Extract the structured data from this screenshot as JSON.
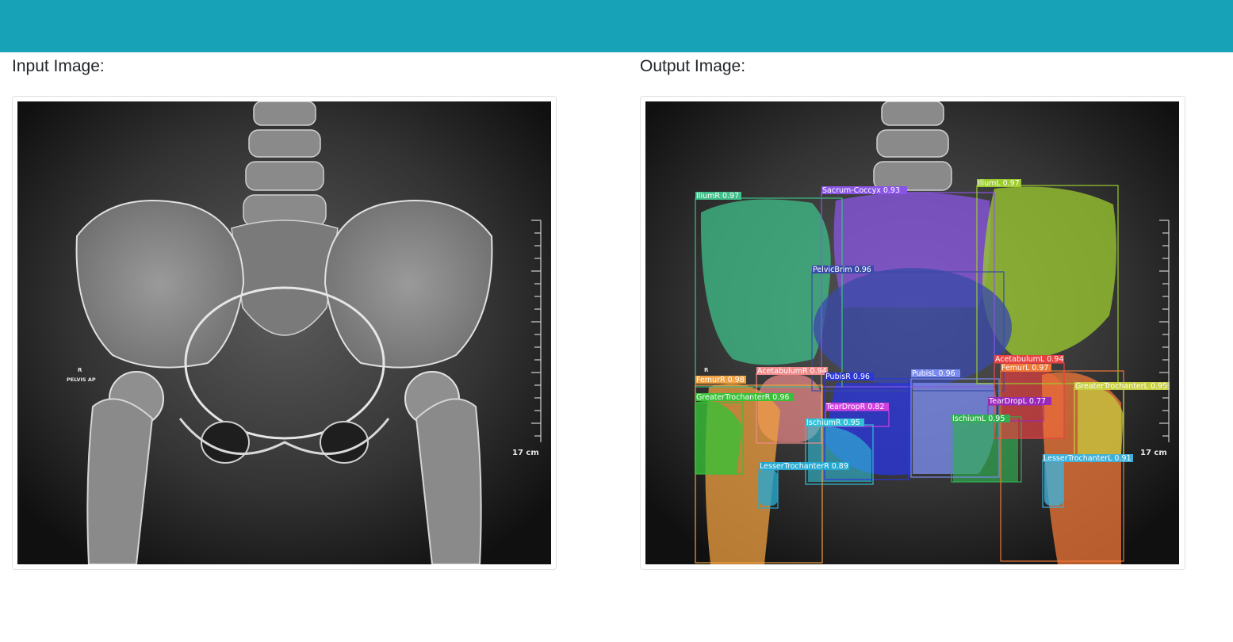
{
  "header": {
    "color": "#17a2b8"
  },
  "input_panel": {
    "title": "Input Image:",
    "image": {
      "side_marker": "R",
      "view_label": "PELVIS AP",
      "scale_label": "17 cm"
    }
  },
  "output_panel": {
    "title": "Output Image:",
    "image": {
      "side_marker": "R",
      "scale_label": "17 cm"
    },
    "detections": [
      {
        "label": "IliumR 0.97",
        "color": "#3fbf8a"
      },
      {
        "label": "Sacrum-Coccyx 0.93",
        "color": "#8a55e6"
      },
      {
        "label": "IliumL 0.97",
        "color": "#9ccc2e"
      },
      {
        "label": "PelvicBrim 0.96",
        "color": "#3a4aa8"
      },
      {
        "label": "AcetabulumR 0.94",
        "color": "#f08a8a"
      },
      {
        "label": "FemurR 0.98",
        "color": "#f0a040"
      },
      {
        "label": "PubisR 0.96",
        "color": "#2a36d8"
      },
      {
        "label": "PubisL 0.96",
        "color": "#7a8cf0"
      },
      {
        "label": "GreaterTrochanterR 0.96",
        "color": "#38c038"
      },
      {
        "label": "TearDropR 0.82",
        "color": "#d040e0"
      },
      {
        "label": "IschiumR 0.95",
        "color": "#30c0d8"
      },
      {
        "label": "IschiumL 0.95",
        "color": "#30b050"
      },
      {
        "label": "TearDropL 0.77",
        "color": "#9a28b8"
      },
      {
        "label": "AcetabulumL 0.94",
        "color": "#e84040"
      },
      {
        "label": "FemurL 0.97",
        "color": "#f07838"
      },
      {
        "label": "GreaterTrochanterL 0.95",
        "color": "#c8d040"
      },
      {
        "label": "LesserTrochanterR 0.89",
        "color": "#28a8d0"
      },
      {
        "label": "LesserTrochanterL 0.91",
        "color": "#40b0d8"
      }
    ]
  }
}
